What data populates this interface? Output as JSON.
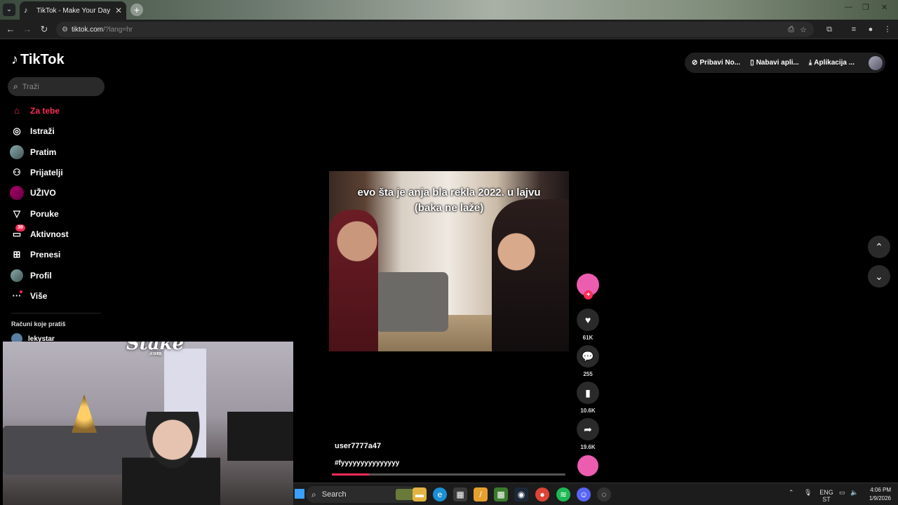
{
  "browser": {
    "tab_title": "TikTok - Make Your Day",
    "tab_close": "✕",
    "new_tab": "+",
    "url_host": "tiktok.com",
    "url_path": "/?lang=hr"
  },
  "sidebar": {
    "logo_text": "TikTok",
    "search_placeholder": "Traži",
    "items": [
      {
        "label": "Za tebe",
        "icon": "home-icon",
        "active": true
      },
      {
        "label": "Istraži",
        "icon": "compass-icon"
      },
      {
        "label": "Pratim",
        "icon": "following-avatar-icon"
      },
      {
        "label": "Prijatelji",
        "icon": "friends-icon"
      },
      {
        "label": "UŽIVO",
        "icon": "live-avatar-icon"
      },
      {
        "label": "Poruke",
        "icon": "send-icon"
      },
      {
        "label": "Aktivnost",
        "icon": "activity-icon",
        "badge": "39"
      },
      {
        "label": "Prenesi",
        "icon": "upload-icon"
      },
      {
        "label": "Profil",
        "icon": "profile-avatar-icon"
      },
      {
        "label": "Više",
        "icon": "more-icon"
      }
    ],
    "following_header": "Računi koje pratiš",
    "following_users": [
      "lekystar"
    ]
  },
  "header": {
    "pill1": "Pribavi No...",
    "pill2": "Nabavi apli...",
    "pill3": "Aplikacija ..."
  },
  "video": {
    "caption_line1": "evo šta je anja bla rekla 2022. u lajvu",
    "caption_line2": "(baka ne laže)",
    "username": "user7777a47",
    "description": "#fyyyyyyyyyyyyyyy",
    "progress": 0.16
  },
  "actions": {
    "likes": "61K",
    "comments": "255",
    "saves": "10.6K",
    "shares": "19.6K"
  },
  "webcam": {
    "sponsor_logo": "Stake",
    "sponsor_sub": ".com"
  },
  "taskbar": {
    "search_label": "Search",
    "lang_top": "ENG",
    "lang_bottom": "ST",
    "time": "4:06 PM",
    "date": "1/9/2026"
  },
  "colors": {
    "accent": "#fe2c55",
    "creator_avatar": "#ec5db0"
  }
}
